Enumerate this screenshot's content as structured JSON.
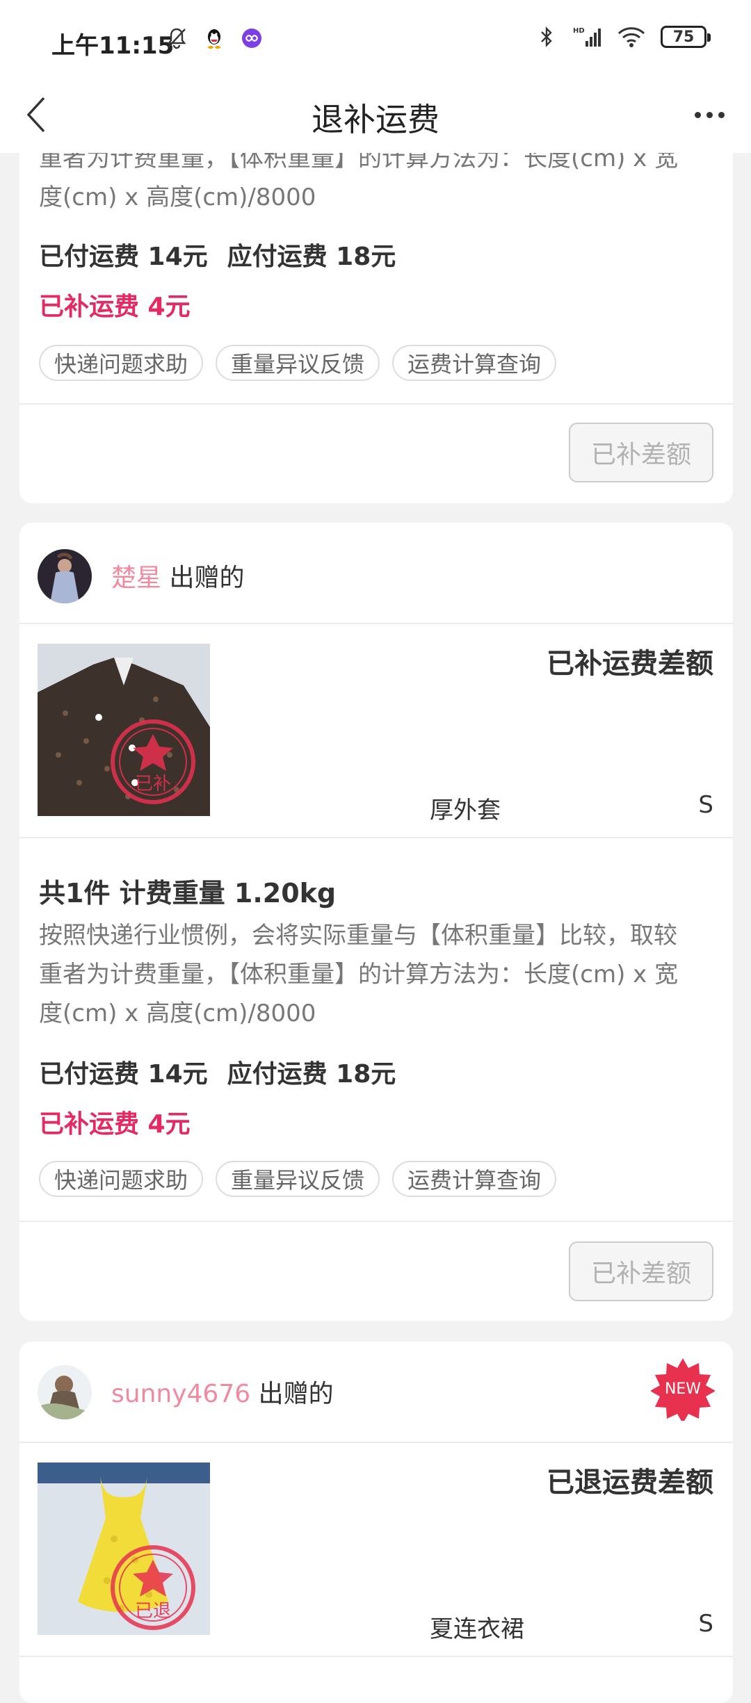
{
  "status_bar": {
    "time": "上午11:15",
    "battery": "75",
    "signal_label": "HD"
  },
  "header": {
    "title": "退补运费"
  },
  "card_top": {
    "desc_tail": [
      "重者为计费重量，【体积重量】的计算方法为：长度(cm) x 宽",
      "度(cm) x 高度(cm)/8000"
    ],
    "paid": "已付运费 14元",
    "due": "应付运费 18元",
    "supplement": "已补运费 4元",
    "tags": [
      "快递问题求助",
      "重量异议反馈",
      "运费计算查询"
    ],
    "button": "已补差额"
  },
  "card_middle": {
    "seller_name": "楚星",
    "seller_suffix": "出赠的",
    "status": "已补运费差额",
    "item_name": "厚外套",
    "item_size": "S",
    "stamp": "已补",
    "count_weight": "共1件 计费重量 1.20kg",
    "desc": [
      "按照快递行业惯例，会将实际重量与【体积重量】比较，取较",
      "重者为计费重量，【体积重量】的计算方法为：长度(cm) x 宽",
      "度(cm) x 高度(cm)/8000"
    ],
    "paid": "已付运费 14元",
    "due": "应付运费 18元",
    "supplement": "已补运费 4元",
    "tags": [
      "快递问题求助",
      "重量异议反馈",
      "运费计算查询"
    ],
    "button": "已补差额"
  },
  "card_bottom": {
    "seller_name": "sunny4676",
    "seller_suffix": "出赠的",
    "badge": "NEW",
    "status": "已退运费差额",
    "item_name": "夏连衣裙",
    "item_size": "S",
    "stamp": "已退"
  },
  "colors": {
    "accent": "#e32a63",
    "seller_name": "#f08aa0",
    "badge": "#e8304f"
  }
}
